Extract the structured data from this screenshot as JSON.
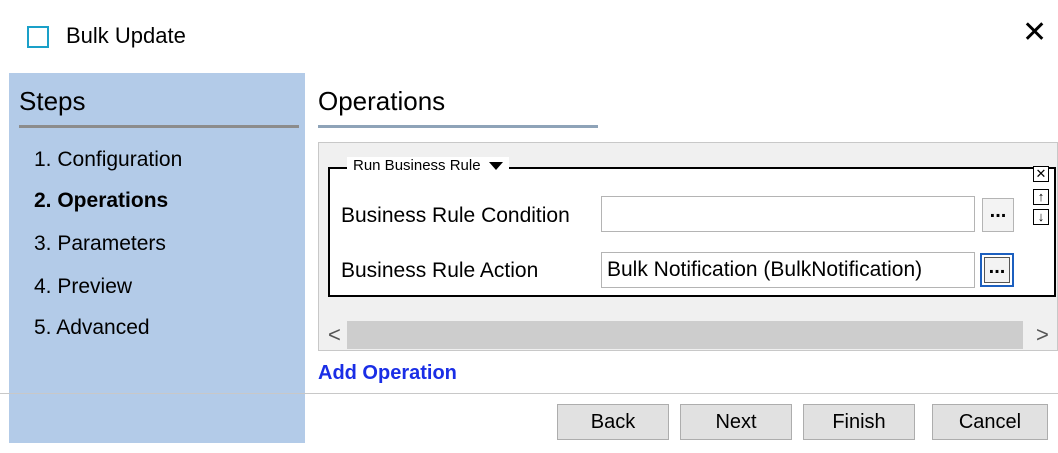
{
  "window": {
    "title": "Bulk Update",
    "close_glyph": "✕"
  },
  "icons": {
    "app": "window-icon",
    "close": "close-icon"
  },
  "steps": {
    "title": "Steps",
    "items": [
      {
        "label": "1. Configuration",
        "active": false
      },
      {
        "label": "2. Operations",
        "active": true
      },
      {
        "label": "3. Parameters",
        "active": false
      },
      {
        "label": "4. Preview",
        "active": false
      },
      {
        "label": "5. Advanced",
        "active": false
      }
    ]
  },
  "operations": {
    "title": "Operations",
    "rule": {
      "type_label": "Run Business Rule",
      "condition_label": "Business Rule Condition",
      "condition_value": "",
      "action_label": "Business Rule Action",
      "action_value": "Bulk Notification (BulkNotification)",
      "browse_label": "..."
    },
    "side_controls": {
      "remove": "✕",
      "up": "↑",
      "down": "↓"
    },
    "scroll": {
      "left": "<",
      "right": ">"
    },
    "add_label": "Add Operation"
  },
  "footer": {
    "back": "Back",
    "next": "Next",
    "finish": "Finish",
    "cancel": "Cancel"
  },
  "colors": {
    "steps_bg": "#b3cbe8",
    "link": "#1a2ee6",
    "focus": "#1c5fbf"
  }
}
